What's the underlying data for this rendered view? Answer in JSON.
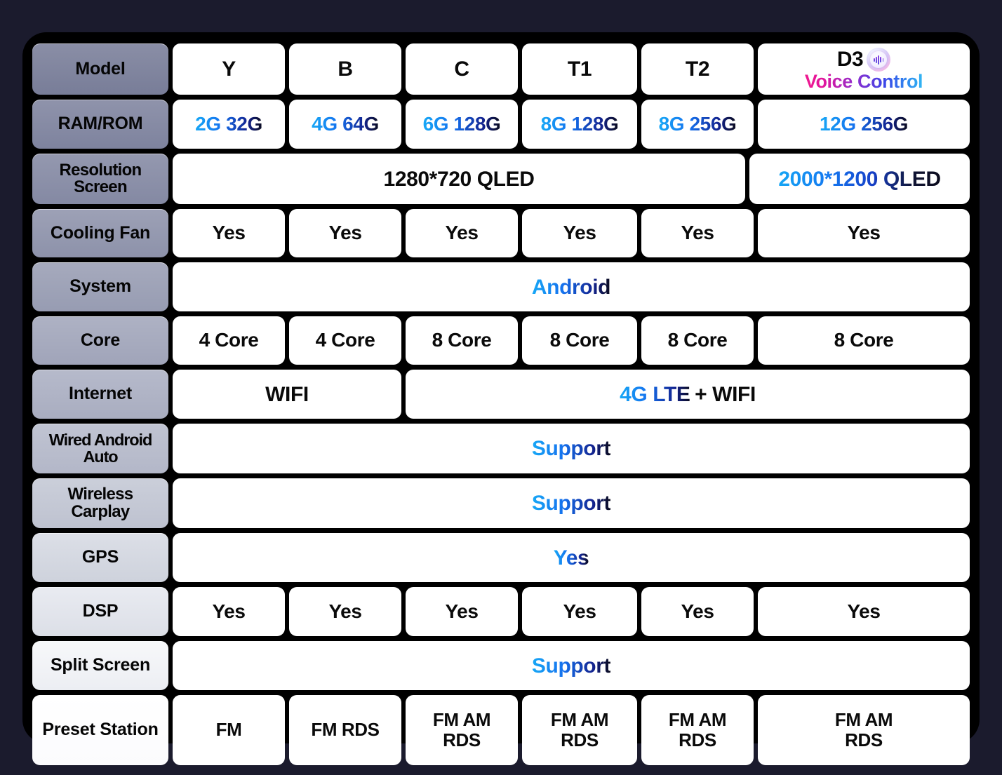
{
  "theme": {
    "page_bg": "#1b1b2d",
    "panel_bg": "#000000",
    "cell_bg": "#ffffff",
    "accent_blue": "#16a6f5",
    "accent_navy": "#0b0b1c",
    "accent_magenta": "#f0188f"
  },
  "columns": [
    "Y",
    "B",
    "C",
    "T1",
    "T2",
    "D3"
  ],
  "d3_header": {
    "model": "D3",
    "subtitle": "Voice Control",
    "icon": "voice-waveform-icon"
  },
  "rows": {
    "model": {
      "label": "Model",
      "values": [
        "Y",
        "B",
        "C",
        "T1",
        "T2"
      ]
    },
    "ram_rom": {
      "label": "RAM/ROM",
      "values": [
        "2G 32G",
        "4G 64G",
        "6G 128G",
        "8G 128G",
        "8G 256G",
        "12G 256G"
      ]
    },
    "resolution": {
      "label": "Resolution Screen",
      "label_line1": "Resolution",
      "label_line2": "Screen",
      "span5": "1280*720 QLED",
      "d3": "2000*1200 QLED"
    },
    "cooling_fan": {
      "label": "Cooling Fan",
      "values": [
        "Yes",
        "Yes",
        "Yes",
        "Yes",
        "Yes",
        "Yes"
      ]
    },
    "system": {
      "label": "System",
      "value": "Android"
    },
    "core": {
      "label": "Core",
      "values": [
        "4 Core",
        "4 Core",
        "8 Core",
        "8 Core",
        "8 Core",
        "8 Core"
      ]
    },
    "internet": {
      "label": "Internet",
      "span2": "WIFI",
      "span4_blue": "4G LTE",
      "span4_black": "+ WIFI"
    },
    "wired_android_auto": {
      "label": "Wired Android Auto",
      "label_line1": "Wired Android",
      "label_line2": "Auto",
      "value": "Support"
    },
    "wireless_carplay": {
      "label": "Wireless Carplay",
      "label_line1": "Wireless",
      "label_line2": "Carplay",
      "value": "Support"
    },
    "gps": {
      "label": "GPS",
      "value": "Yes"
    },
    "dsp": {
      "label": "DSP",
      "values": [
        "Yes",
        "Yes",
        "Yes",
        "Yes",
        "Yes",
        "Yes"
      ]
    },
    "split_screen": {
      "label": "Split Screen",
      "value": "Support"
    },
    "preset_station": {
      "label": "Preset Station",
      "values": [
        {
          "line1": "FM",
          "line2": ""
        },
        {
          "line1": "FM RDS",
          "line2": ""
        },
        {
          "line1": "FM AM",
          "line2": "RDS"
        },
        {
          "line1": "FM AM",
          "line2": "RDS"
        },
        {
          "line1": "FM AM",
          "line2": "RDS"
        },
        {
          "line1": "FM AM",
          "line2": "RDS"
        }
      ]
    }
  }
}
